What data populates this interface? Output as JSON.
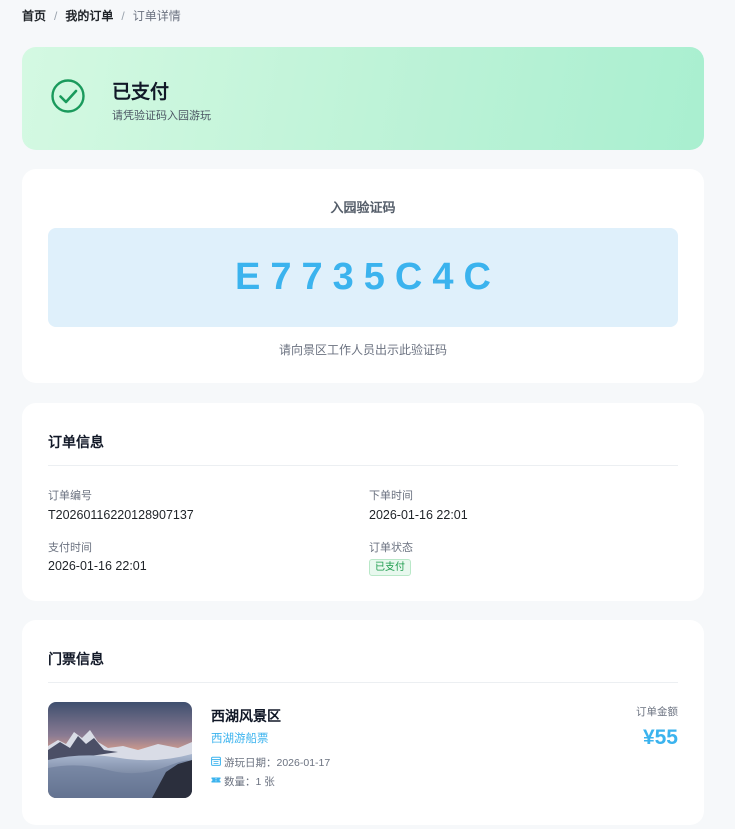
{
  "breadcrumb": {
    "home": "首页",
    "orders": "我的订单",
    "current": "订单详情",
    "separator": "/"
  },
  "status": {
    "title": "已支付",
    "subtitle": "请凭验证码入园游玩",
    "icon": "check-circle-icon",
    "color": "#1a9a5c"
  },
  "verification": {
    "label": "入园验证码",
    "code": "E7735C4C",
    "hint": "请向景区工作人员出示此验证码",
    "accent": "#3bb3ee"
  },
  "order_info": {
    "title": "订单信息",
    "order_no_label": "订单编号",
    "order_no": "T20260116220128907137",
    "created_label": "下单时间",
    "created": "2026-01-16 22:01",
    "paid_label": "支付时间",
    "paid": "2026-01-16 22:01",
    "status_label": "订单状态",
    "status": "已支付"
  },
  "ticket_info": {
    "title": "门票信息",
    "scenic_name": "西湖风景区",
    "ticket_type": "西湖游船票",
    "visit_date_label": "游玩日期：",
    "visit_date": "2026-01-17",
    "quantity_label": "数量：",
    "quantity": "1 张",
    "amount_label": "订单金额",
    "amount": "¥55",
    "image": "mountain-sea-of-clouds-photo"
  }
}
